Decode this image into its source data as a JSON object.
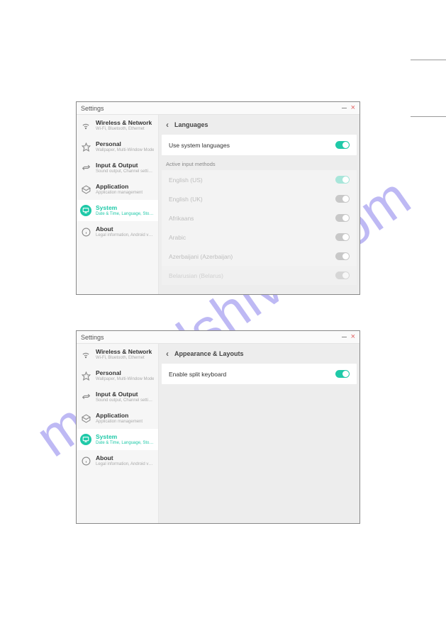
{
  "watermark": "manualshive.com",
  "page_lines": {
    "top1": 84,
    "top2": 164
  },
  "sidebar": {
    "items": [
      {
        "label": "Wireless & Network",
        "sub": "Wi-Fi, Bluetooth, Ethernet"
      },
      {
        "label": "Personal",
        "sub": "Wallpaper, Multi-Window Mode"
      },
      {
        "label": "Input & Output",
        "sub": "Sound output, Channel settings"
      },
      {
        "label": "Application",
        "sub": "Application management"
      },
      {
        "label": "System",
        "sub": "Date & Time, Language, Storage"
      },
      {
        "label": "About",
        "sub": "Legal information, Android version"
      }
    ]
  },
  "window1": {
    "title": "Settings",
    "header": "Languages",
    "use_system_label": "Use system languages",
    "use_system_on": true,
    "section_label": "Active input methods",
    "langs": [
      {
        "name": "English (US)",
        "state": "on-dim"
      },
      {
        "name": "English (UK)",
        "state": "off"
      },
      {
        "name": "Afrikaans",
        "state": "off"
      },
      {
        "name": "Arabic",
        "state": "off"
      },
      {
        "name": "Azerbaijani (Azerbaijan)",
        "state": "off"
      },
      {
        "name": "Belarusian (Belarus)",
        "state": "off"
      }
    ]
  },
  "window2": {
    "title": "Settings",
    "header": "Appearance & Layouts",
    "toggle_label": "Enable split keyboard",
    "toggle_on": true
  }
}
